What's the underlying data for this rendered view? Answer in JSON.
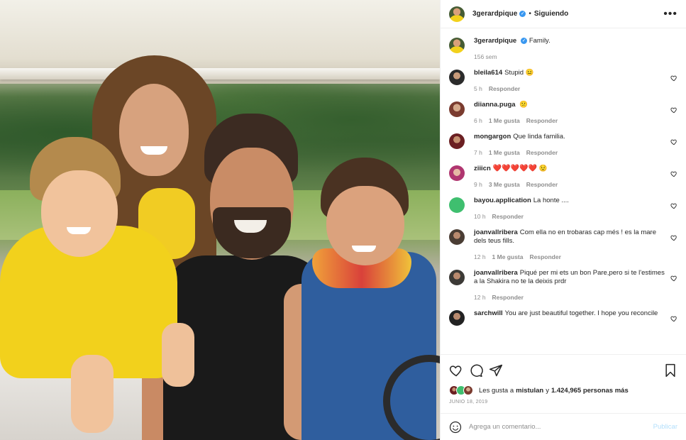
{
  "post": {
    "username": "3gerardpique",
    "follow_label": "Siguiendo",
    "dot": "•",
    "more_icon": "more-icon",
    "caption_user": "3gerardpique",
    "caption_text": "Family.",
    "caption_age": "156 sem"
  },
  "comments": [
    {
      "user": "bleila614",
      "text": "Stupid",
      "emoji": "😐",
      "time": "5 h",
      "likes": "",
      "reply": "Responder"
    },
    {
      "user": "diianna.puga",
      "text": "",
      "emoji": "😕",
      "time": "6 h",
      "likes": "1 Me gusta",
      "reply": "Responder"
    },
    {
      "user": "mongargon",
      "text": "Que linda familia.",
      "emoji": "",
      "time": "7 h",
      "likes": "1 Me gusta",
      "reply": "Responder"
    },
    {
      "user": "ziiicn",
      "text": "❤️❤️❤️❤️❤️",
      "emoji": "😟",
      "time": "9 h",
      "likes": "3 Me gusta",
      "reply": "Responder"
    },
    {
      "user": "bayou.application",
      "text": "La honte ....",
      "emoji": "",
      "time": "10 h",
      "likes": "",
      "reply": "Responder"
    },
    {
      "user": "joanvallribera",
      "text": "Com ella no en trobaras cap més ! es la mare dels teus fills.",
      "emoji": "",
      "time": "12 h",
      "likes": "1 Me gusta",
      "reply": "Responder"
    },
    {
      "user": "joanvallribera",
      "text": "Piqué per mi ets un bon Pare,pero si te l'estimes a la Shakira no te la deixis prdr",
      "emoji": "",
      "time": "12 h",
      "likes": "",
      "reply": "Responder"
    },
    {
      "user": "sarchwill",
      "text": "You are just beautiful together. I hope you reconcile",
      "emoji": "",
      "time": "",
      "likes": "",
      "reply": ""
    }
  ],
  "actions": {
    "likes_prefix": "Les gusta a",
    "likes_user": "mistulan",
    "likes_mid": "y",
    "likes_count": "1.424,965 personas más",
    "date": "JUNIO 18, 2019"
  },
  "add_comment": {
    "placeholder": "Agrega un comentario...",
    "publish_label": "Publicar"
  },
  "colors": {
    "accent": "#3897f0",
    "publish_disabled": "#b2dffc",
    "muted": "#8e8e8e"
  }
}
